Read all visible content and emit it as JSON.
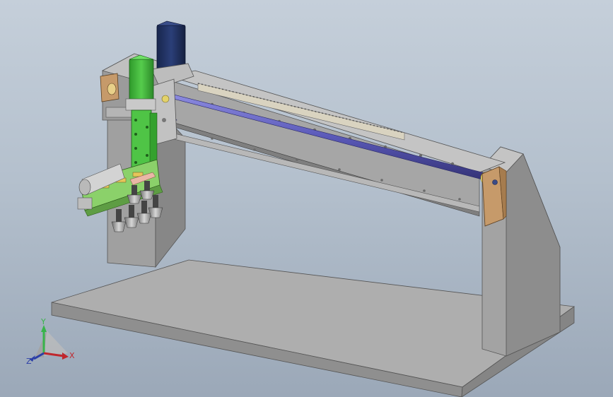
{
  "viewport": {
    "background_top": "#c5cfda",
    "background_bottom": "#9ba8b8"
  },
  "colors": {
    "steel": "#a9a9a9",
    "steel_dark": "#7c7c7c",
    "motor_green": "#3fb73a",
    "motor_blue": "#1f2f5e",
    "rod_blue": "#5a59b8",
    "bracket_bronze": "#c69a6a",
    "pcb_green": "#8bd16a",
    "axis_x": "#c0272d",
    "axis_y": "#38b44a",
    "axis_z": "#2b3ea7"
  },
  "triad": {
    "x_label": "X",
    "y_label": "Y",
    "z_label": "Z"
  }
}
